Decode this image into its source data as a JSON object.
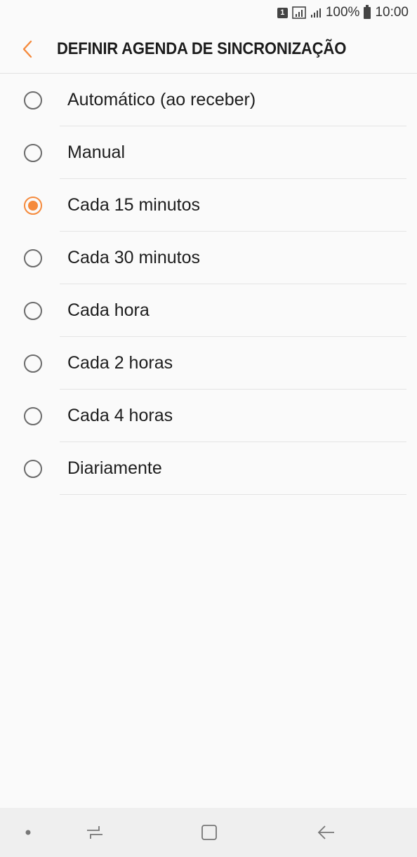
{
  "status_bar": {
    "sim_label": "1",
    "battery": "100%",
    "time": "10:00"
  },
  "header": {
    "title": "DEFINIR AGENDA DE SINCRONIZAÇÃO",
    "back_icon": "chevron-left-icon",
    "accent_color": "#f58a3c"
  },
  "options": [
    {
      "label": "Automático (ao receber)",
      "selected": false
    },
    {
      "label": "Manual",
      "selected": false
    },
    {
      "label": "Cada 15 minutos",
      "selected": true
    },
    {
      "label": "Cada 30 minutos",
      "selected": false
    },
    {
      "label": "Cada hora",
      "selected": false
    },
    {
      "label": "Cada 2 horas",
      "selected": false
    },
    {
      "label": "Cada 4 horas",
      "selected": false
    },
    {
      "label": "Diariamente",
      "selected": false
    }
  ],
  "nav_bar": {
    "icons": [
      "dot-icon",
      "recents-icon",
      "home-icon",
      "back-arrow-icon"
    ]
  }
}
